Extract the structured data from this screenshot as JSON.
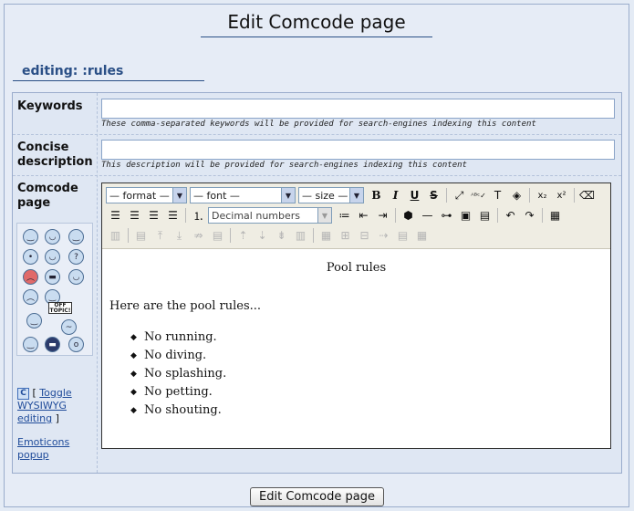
{
  "page_title": "Edit Comcode page",
  "editing_heading": "editing: :rules",
  "fields": {
    "keywords": {
      "label": "Keywords",
      "value": "",
      "hint": "These comma-separated keywords will be provided for search-engines indexing this content"
    },
    "description": {
      "label_line1": "Concise",
      "label_line2": "description",
      "value": "",
      "hint": "This description will be provided for search-engines indexing this content"
    },
    "comcode": {
      "label_line1": "Comcode",
      "label_line2": "page"
    }
  },
  "toolbar": {
    "format_select": "— format —",
    "font_select": "— font —",
    "size_select": "— size —",
    "bold": "B",
    "italic": "I",
    "underline": "U",
    "strike": "S",
    "list_style_select": "Decimal numbers",
    "subscript": "x₂",
    "superscript": "x²"
  },
  "editor_content": {
    "title": "Pool rules",
    "intro": "Here are the pool rules...",
    "items": [
      "No running.",
      "No diving.",
      "No splashing.",
      "No petting.",
      "No shouting."
    ]
  },
  "sidebar": {
    "toggle_open_bracket": "[",
    "toggle_link": "Toggle WYSIWYG editing",
    "toggle_close_bracket": "]",
    "emoticons_popup": "Emoticons popup",
    "offtopic_text": "OFF TOPIC!"
  },
  "submit_button": "Edit Comcode page",
  "colors": {
    "page_bg": "#e4ebf5",
    "heading_accent": "#2a4f86",
    "link": "#1f4b9a",
    "toolbar_bg": "#efede3"
  }
}
